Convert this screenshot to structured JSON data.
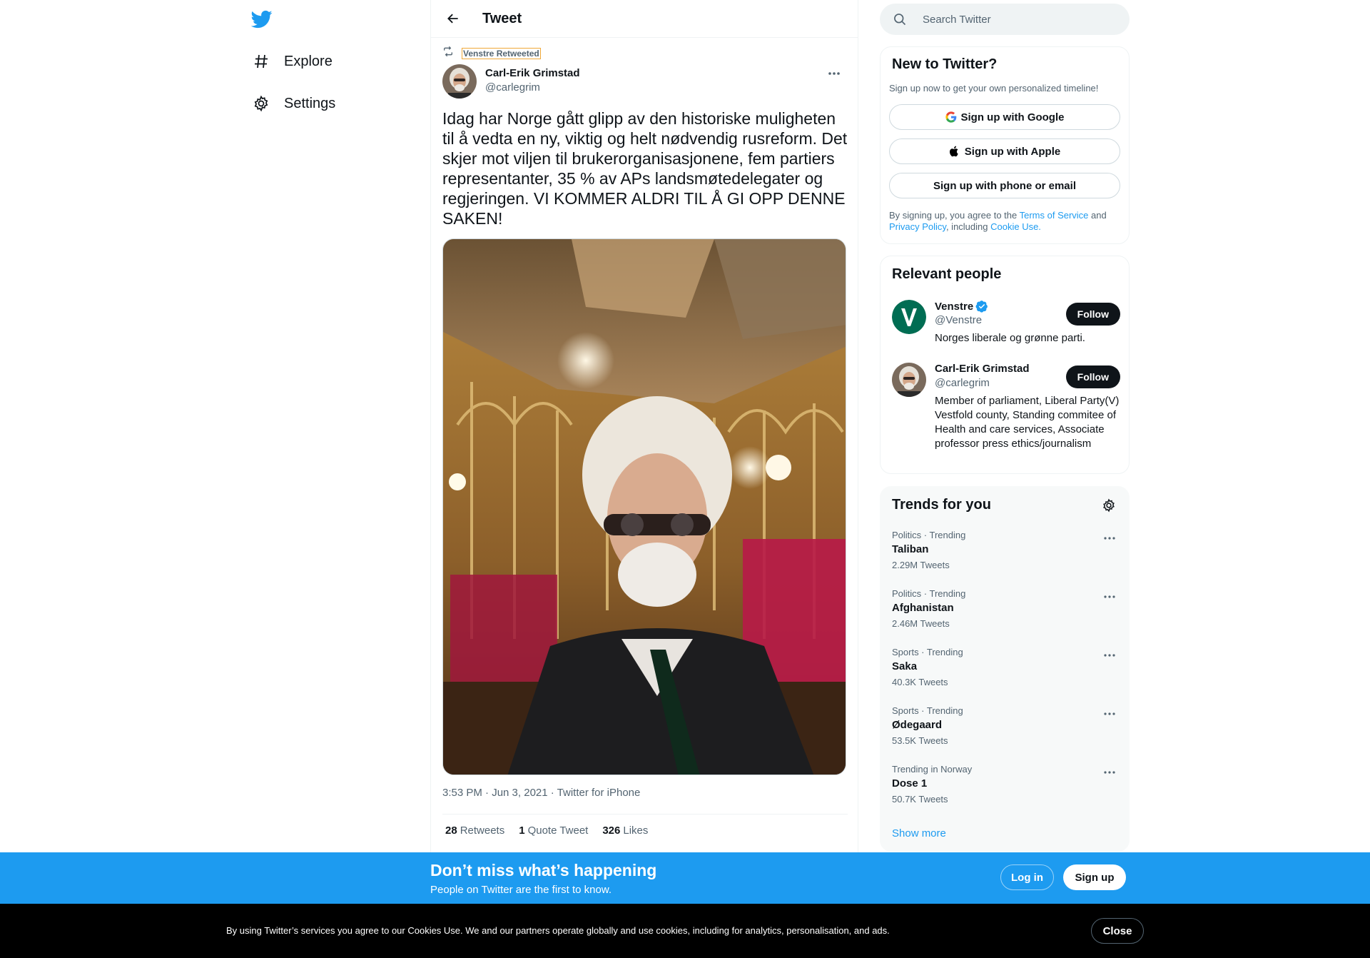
{
  "nav": {
    "items": [
      {
        "label": "Explore",
        "icon": "hashtag-icon"
      },
      {
        "label": "Settings",
        "icon": "gear-icon"
      }
    ]
  },
  "header": {
    "title": "Tweet"
  },
  "tweet": {
    "retweeted_by": "Venstre Retweeted",
    "author_name": "Carl-Erik Grimstad",
    "author_handle": "@carlegrim",
    "text": "Idag har Norge gått glipp av den historiske muligheten til å vedta en ny, viktig og helt nødvendig rusreform. Det skjer mot viljen til brukerorganisasjonene, fem partiers representanter, 35 % av APs landsmøtedelegater og regjeringen. VI KOMMER ALDRI TIL Å GI OPP DENNE SAKEN!",
    "timestamp": "3:53 PM · Jun 3, 2021 · Twitter for iPhone",
    "stats": {
      "retweets_count": "28",
      "retweets_label": "Retweets",
      "quotes_count": "1",
      "quotes_label": "Quote Tweet",
      "likes_count": "326",
      "likes_label": "Likes"
    }
  },
  "search": {
    "placeholder": "Search Twitter"
  },
  "new_to_twitter": {
    "title": "New to Twitter?",
    "subtitle": "Sign up now to get your own personalized timeline!",
    "google_label": "Sign up with Google",
    "apple_label": "Sign up with Apple",
    "phone_label": "Sign up with phone or email",
    "legal_prefix": "By signing up, you agree to the ",
    "terms_link": "Terms of Service",
    "legal_and": " and ",
    "privacy_link": "Privacy Policy",
    "legal_including": ", including ",
    "cookie_link": "Cookie Use."
  },
  "relevant_people": {
    "title": "Relevant people",
    "people": [
      {
        "name": "Venstre",
        "handle": "@Venstre",
        "bio": "Norges liberale og grønne parti.",
        "verified": true,
        "follow_label": "Follow"
      },
      {
        "name": "Carl-Erik Grimstad",
        "handle": "@carlegrim",
        "bio": "Member of parliament, Liberal Party(V) Vestfold county, Standing commitee of Health and care services, Associate professor press ethics/journalism",
        "verified": false,
        "follow_label": "Follow"
      }
    ]
  },
  "trends": {
    "title": "Trends for you",
    "items": [
      {
        "context": "Politics · Trending",
        "name": "Taliban",
        "count": "2.29M Tweets"
      },
      {
        "context": "Politics · Trending",
        "name": "Afghanistan",
        "count": "2.46M Tweets"
      },
      {
        "context": "Sports · Trending",
        "name": "Saka",
        "count": "40.3K Tweets"
      },
      {
        "context": "Sports · Trending",
        "name": "Ødegaard",
        "count": "53.5K Tweets"
      },
      {
        "context": "Trending in Norway",
        "name": "Dose 1",
        "count": "50.7K Tweets"
      }
    ],
    "show_more": "Show more"
  },
  "signup_bar": {
    "title": "Don’t miss what’s happening",
    "subtitle": "People on Twitter are the first to know.",
    "login_label": "Log in",
    "signup_label": "Sign up"
  },
  "cookie_bar": {
    "text": "By using Twitter’s services you agree to our Cookies Use. We and our partners operate globally and use cookies, including for analytics, personalisation, and ads.",
    "close_label": "Close"
  },
  "colors": {
    "accent": "#1d9bf0",
    "text_primary": "#0f1419",
    "text_secondary": "#536471",
    "cookie_bar_bg": "#000000",
    "follow_button_bg": "#0f1419"
  }
}
